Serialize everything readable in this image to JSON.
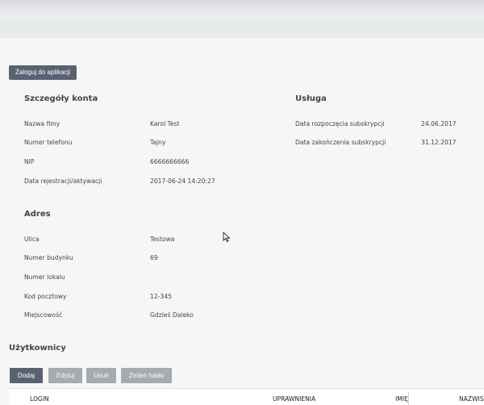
{
  "header": {
    "login_button": "Zaloguj do aplikacji"
  },
  "account": {
    "title": "Szczegóły konta",
    "rows": [
      {
        "label": "Nazwa fimy",
        "value": "Karol Test"
      },
      {
        "label": "Numer telefonu",
        "value": "Tajny"
      },
      {
        "label": "NIP",
        "value": "6666666666"
      },
      {
        "label": "Data rejestracji/aktywacji",
        "value": "2017-06-24 14:20:27"
      }
    ]
  },
  "service": {
    "title": "Usługa",
    "rows": [
      {
        "label": "Data rozpoczęcia subskrypcji",
        "value": "24.06.2017"
      },
      {
        "label": "Data zakończenia subskrypcji",
        "value": "31.12.2017"
      }
    ]
  },
  "address": {
    "title": "Adres",
    "rows": [
      {
        "label": "Ulica",
        "value": "Testowa"
      },
      {
        "label": "Numer budynku",
        "value": "69"
      },
      {
        "label": "Numer lokalu",
        "value": ""
      },
      {
        "label": "Kod pocztowy",
        "value": "12-345"
      },
      {
        "label": "Miejscowość",
        "value": "Gdzieś Daleko"
      }
    ]
  },
  "users": {
    "title": "Użytkownicy",
    "buttons": {
      "add": "Dodaj",
      "edit": "Edytuj",
      "delete": "Usuń",
      "change_password": "Zmień hasło"
    },
    "columns": [
      "LOGIN",
      "UPRAWNIENIA",
      "IMIĘ",
      "NAZWIS"
    ]
  },
  "colors": {
    "primary_button": "#5a6272",
    "disabled_button": "#a7aab1"
  }
}
